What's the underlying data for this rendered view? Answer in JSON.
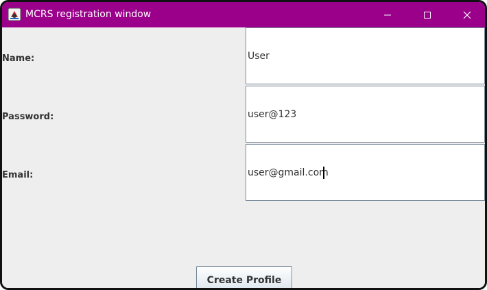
{
  "window": {
    "title": "MCRS registration window",
    "titlebar_color": "#9b008b",
    "background_color": "#eeeeee",
    "controls": {
      "minimize_icon": "minimize-icon",
      "maximize_icon": "maximize-icon",
      "close_icon": "close-icon"
    }
  },
  "form": {
    "name": {
      "label": "Name:",
      "value": "User"
    },
    "password": {
      "label": "Password:",
      "value": "user@123"
    },
    "email": {
      "label": "Email:",
      "value": "user@gmail.com"
    },
    "submit_label": "Create Profile"
  }
}
